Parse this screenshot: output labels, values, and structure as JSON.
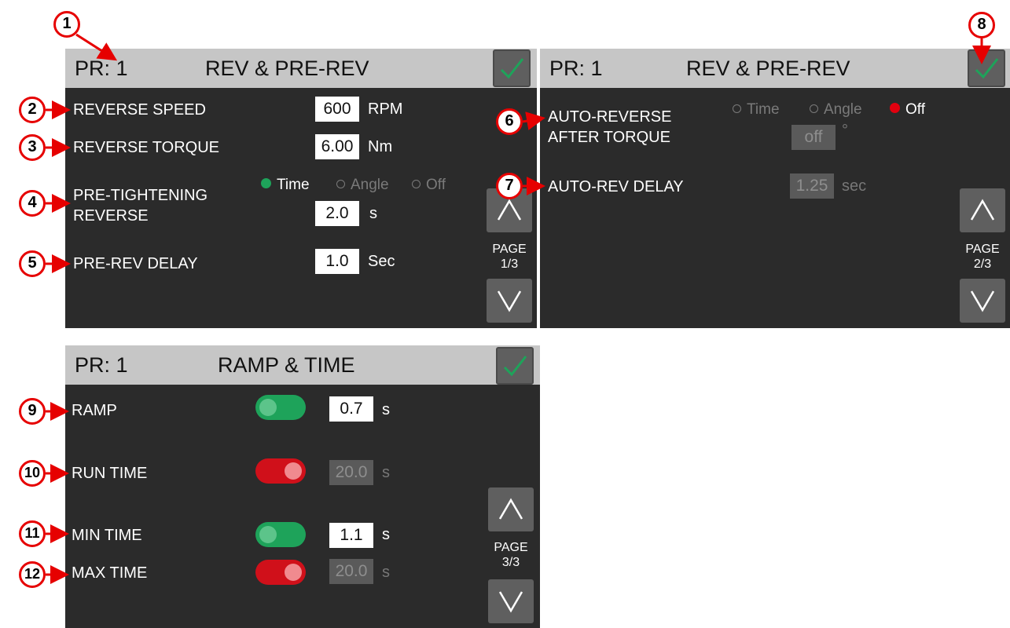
{
  "panels": {
    "p1": {
      "pr": "PR: 1",
      "title": "REV & PRE-REV",
      "reverse_speed": {
        "label": "REVERSE SPEED",
        "value": "600",
        "unit": "RPM"
      },
      "reverse_torque": {
        "label": "REVERSE TORQUE",
        "value": "6.00",
        "unit": "Nm"
      },
      "pre_tightening": {
        "label_1": "PRE-TIGHTENING",
        "label_2": "REVERSE",
        "options": [
          "Time",
          "Angle",
          "Off"
        ],
        "selected": "Time",
        "value": "2.0",
        "unit": "s"
      },
      "pre_rev_delay": {
        "label": "PRE-REV DELAY",
        "value": "1.0",
        "unit": "Sec"
      },
      "page": {
        "label": "PAGE",
        "number": "1/3"
      }
    },
    "p2": {
      "pr": "PR: 1",
      "title": "REV & PRE-REV",
      "auto_reverse": {
        "label_1": "AUTO-REVERSE",
        "label_2": "AFTER TORQUE",
        "options": [
          "Time",
          "Angle",
          "Off"
        ],
        "selected": "Off",
        "value": "off",
        "unit": "°"
      },
      "auto_rev_delay": {
        "label": "AUTO-REV DELAY",
        "value": "1.25",
        "unit": "sec"
      },
      "page": {
        "label": "PAGE",
        "number": "2/3"
      }
    },
    "p3": {
      "pr": "PR: 1",
      "title": "RAMP & TIME",
      "ramp": {
        "label": "RAMP",
        "toggle": "on",
        "value": "0.7",
        "unit": "s"
      },
      "run_time": {
        "label": "RUN TIME",
        "toggle": "off",
        "value": "20.0",
        "unit": "s"
      },
      "min_time": {
        "label": "MIN TIME",
        "toggle": "on",
        "value": "1.1",
        "unit": "s"
      },
      "max_time": {
        "label": "MAX TIME",
        "toggle": "off",
        "value": "20.0",
        "unit": "s"
      },
      "page": {
        "label": "PAGE",
        "number": "3/3"
      }
    }
  },
  "callouts": [
    "1",
    "2",
    "3",
    "4",
    "5",
    "6",
    "7",
    "8",
    "9",
    "10",
    "11",
    "12"
  ],
  "icons": {
    "confirm": "check-icon",
    "up": "chevron-up-icon",
    "down": "chevron-down-icon"
  },
  "colors": {
    "accent_green": "#1ea35a",
    "accent_red": "#e1000f",
    "callout": "#e60000",
    "panel_bg": "#2b2b2b",
    "header_bg": "#c6c6c6"
  }
}
